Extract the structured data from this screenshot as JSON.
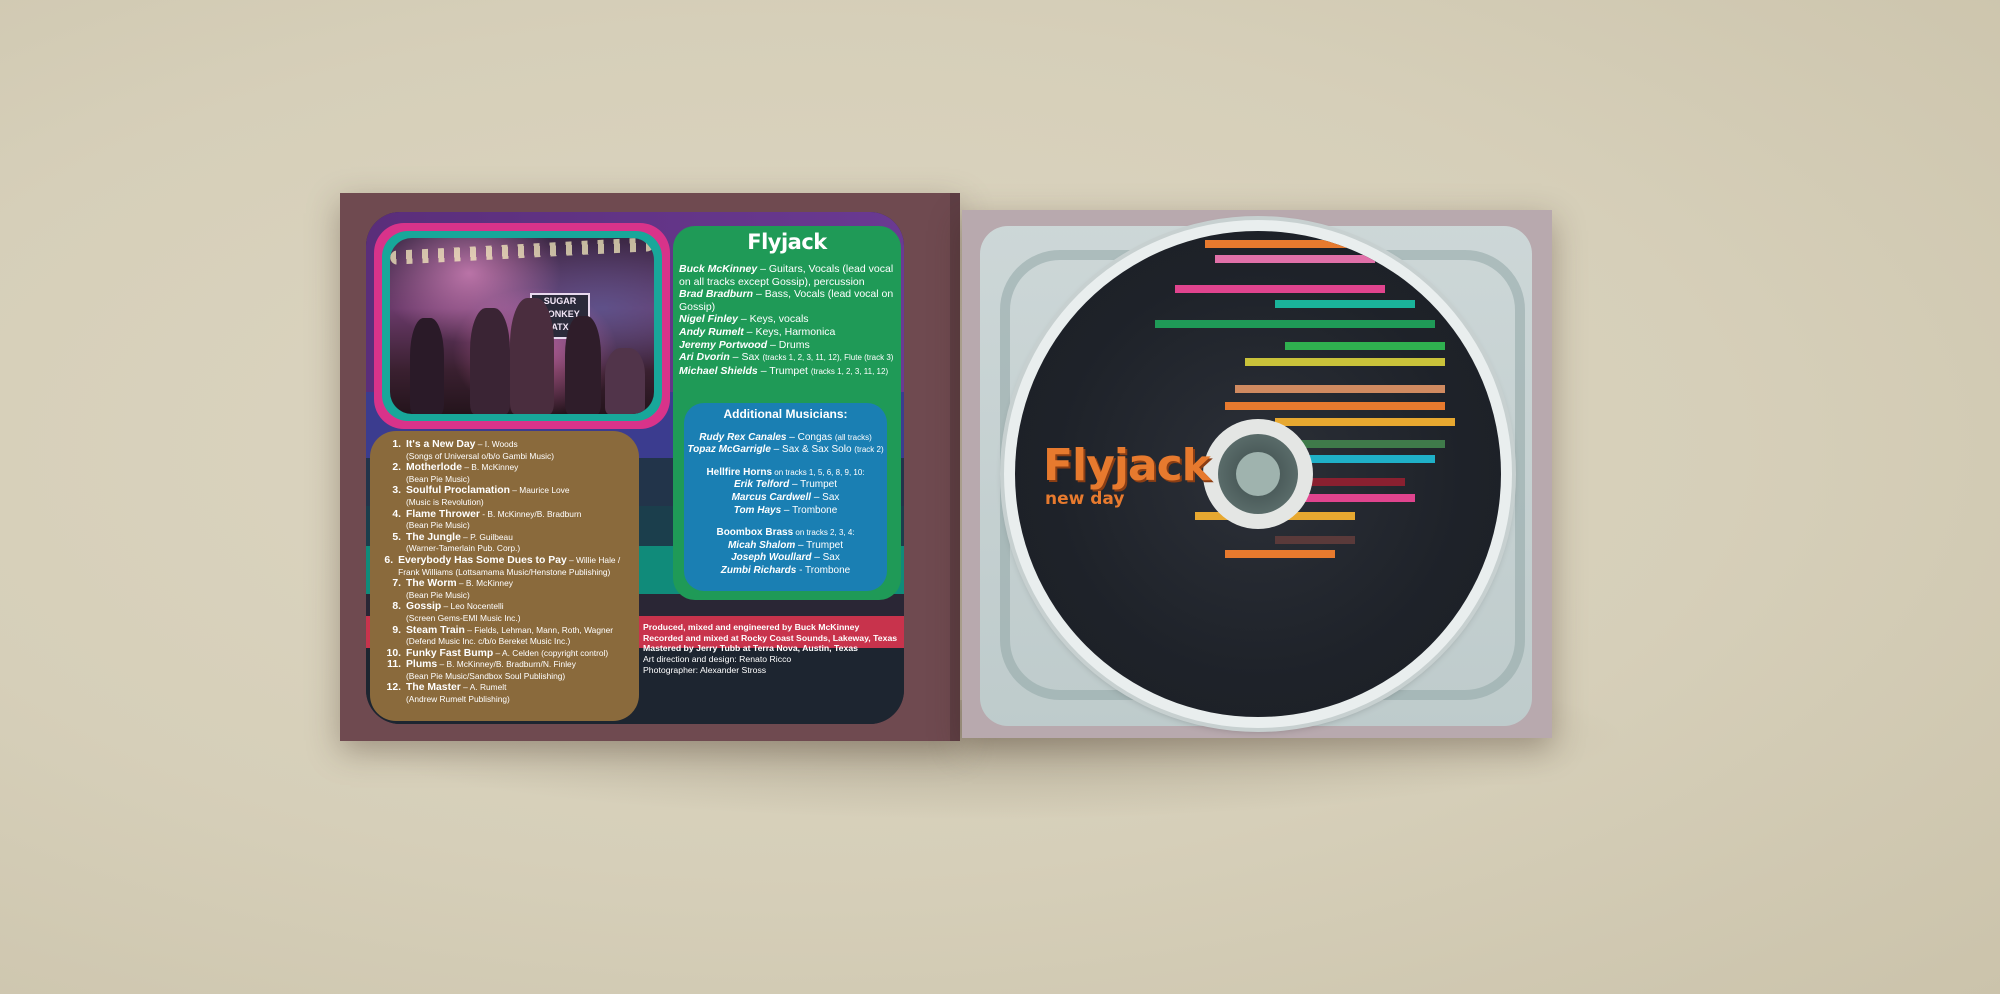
{
  "band_name": "Flyjack",
  "album": {
    "title": "Flyjack",
    "subtitle": "new day"
  },
  "photo": {
    "sign_lines": [
      "SUGAR",
      "MONKEY",
      "ATX"
    ]
  },
  "members": [
    {
      "name": "Buck McKinney",
      "role": " – Guitars, Vocals (lead vocal on all tracks except Gossip), percussion"
    },
    {
      "name": "Brad Bradburn",
      "role": " – Bass, Vocals (lead vocal on Gossip)"
    },
    {
      "name": "Nigel Finley",
      "role": " – Keys, vocals"
    },
    {
      "name": "Andy Rumelt",
      "role": " – Keys, Harmonica"
    },
    {
      "name": "Jeremy Portwood",
      "role": " – Drums"
    },
    {
      "name": "Ari Dvorin",
      "role": " – Sax ",
      "note": "(tracks 1, 2, 3, 11, 12), Flute (track 3)"
    },
    {
      "name": "Michael Shields",
      "role": " – Trumpet ",
      "note": "(tracks 1, 2, 3, 11, 12)"
    }
  ],
  "additional": {
    "heading": "Additional Musicians:",
    "solo": [
      {
        "name": "Rudy Rex Canales",
        "role": " – Congas ",
        "note": "(all tracks)"
      },
      {
        "name": "Topaz McGarrigle",
        "role": " – Sax & Sax Solo ",
        "note": "(track 2)"
      }
    ],
    "hellfire": {
      "title": "Hellfire Horns",
      "note": " on tracks 1, 5, 6, 8, 9, 10:",
      "players": [
        {
          "name": "Erik Telford",
          "role": " – Trumpet"
        },
        {
          "name": "Marcus Cardwell",
          "role": " – Sax"
        },
        {
          "name": "Tom Hays",
          "role": " – Trombone"
        }
      ]
    },
    "boombox": {
      "title": "Boombox Brass",
      "note": " on tracks 2, 3, 4:",
      "players": [
        {
          "name": "Micah Shalom",
          "role": " – Trumpet"
        },
        {
          "name": "Joseph Woullard",
          "role": " – Sax"
        },
        {
          "name": "Zumbi Richards",
          "role": " - Trombone"
        }
      ]
    }
  },
  "tracks": [
    {
      "num": "1.",
      "title": "It's a New Day",
      "by": " – I. Woods",
      "pub": "(Songs of Universal o/b/o Gambi Music)"
    },
    {
      "num": "2.",
      "title": "Motherlode",
      "by": " – B. McKinney",
      "pub": "(Bean Pie Music)"
    },
    {
      "num": "3.",
      "title": "Soulful Proclamation",
      "by": " – Maurice Love",
      "pub": "(Music is Revolution)"
    },
    {
      "num": "4.",
      "title": "Flame Thrower",
      "by": " - B. McKinney/B. Bradburn",
      "pub": "(Bean Pie Music)"
    },
    {
      "num": "5.",
      "title": "The Jungle",
      "by": " – P. Guilbeau",
      "pub": "(Warner-Tamerlain Pub. Corp.)"
    },
    {
      "num": "6.",
      "title": "Everybody Has Some Dues to Pay",
      "by": " – Willie Hale / Frank Williams (Lottsamama Music/Henstone Publishing)",
      "pub": ""
    },
    {
      "num": "7.",
      "title": "The Worm",
      "by": " – B. McKinney",
      "pub": "(Bean Pie Music)"
    },
    {
      "num": "8.",
      "title": "Gossip",
      "by": " – Leo Nocentelli",
      "pub": "(Screen Gems-EMI Music Inc.)"
    },
    {
      "num": "9.",
      "title": "Steam Train",
      "by": " – Fields, Lehman, Mann, Roth, Wagner",
      "pub": "(Defend Music Inc. c/b/o Bereket Music Inc.)"
    },
    {
      "num": "10.",
      "title": "Funky Fast Bump",
      "by": " – A. Celden (copyright control)",
      "pub": ""
    },
    {
      "num": "11.",
      "title": "Plums",
      "by": " – B. McKinney/B. Bradburn/N. Finley",
      "pub": "(Bean Pie Music/Sandbox Soul Publishing)"
    },
    {
      "num": "12.",
      "title": "The Master",
      "by": " – A. Rumelt",
      "pub": "(Andrew Rumelt Publishing)"
    }
  ],
  "credits": [
    "Produced, mixed and engineered by Buck McKinney",
    "Recorded and mixed at Rocky Coast Sounds, Lakeway, Texas",
    "Mastered by Jerry Tubb at Terra Nova, Austin, Texas",
    "Art direction and design: Renato Ricco",
    "Photographer: Alexander Stross"
  ],
  "colors": {
    "disc_title": "#e77a2e",
    "panel": "#6f4a50",
    "green": "#1f9a57",
    "blue": "#1a7fb3",
    "tracklist": "#8a6a3c"
  }
}
